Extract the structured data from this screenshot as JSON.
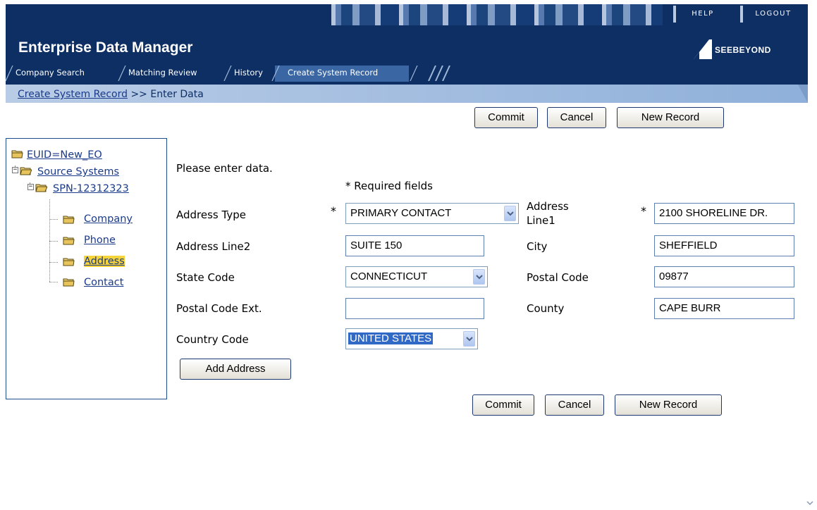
{
  "header": {
    "help": "HELP",
    "logout": "LOGOUT",
    "app_title": "Enterprise Data Manager",
    "logo_text": "SEEBEYOND"
  },
  "tabs": [
    {
      "label": "Company Search",
      "active": false
    },
    {
      "label": "Matching Review",
      "active": false
    },
    {
      "label": "History",
      "active": false
    },
    {
      "label": "Create System Record",
      "active": true
    }
  ],
  "breadcrumb": {
    "link": "Create System Record",
    "separator": ">>",
    "current": "Enter Data"
  },
  "buttons": {
    "commit": "Commit",
    "cancel": "Cancel",
    "new_record": "New Record",
    "add_address": "Add Address"
  },
  "tree": {
    "root": "EUID=New_EO",
    "source_systems": "Source Systems",
    "system": "SPN-12312323",
    "items": [
      "Company",
      "Phone",
      "Address",
      "Contact"
    ],
    "selected": "Address"
  },
  "form": {
    "intro": "Please enter data.",
    "required_note": "* Required fields",
    "required_mark": "*",
    "address_type": {
      "label": "Address Type",
      "value": "PRIMARY CONTACT"
    },
    "address_line1": {
      "label_top": "Address",
      "label_bottom": "Line1",
      "value": "2100 SHORELINE DR."
    },
    "address_line2": {
      "label": "Address Line2",
      "value": "SUITE 150"
    },
    "city": {
      "label": "City",
      "value": "SHEFFIELD"
    },
    "state_code": {
      "label": "State Code",
      "value": "CONNECTICUT"
    },
    "postal_code": {
      "label": "Postal Code",
      "value": "09877"
    },
    "postal_code_ext": {
      "label": "Postal Code Ext.",
      "value": ""
    },
    "county": {
      "label": "County",
      "value": "CAPE BURR"
    },
    "country_code": {
      "label": "Country Code",
      "value": "UNITED STATES"
    }
  },
  "colors": {
    "header_bg": "#0d2f64",
    "subbar": "#8fb0da",
    "link": "#1a3a8a",
    "selected_highlight": "#f5d33a",
    "select_highlight": "#3169c6"
  }
}
